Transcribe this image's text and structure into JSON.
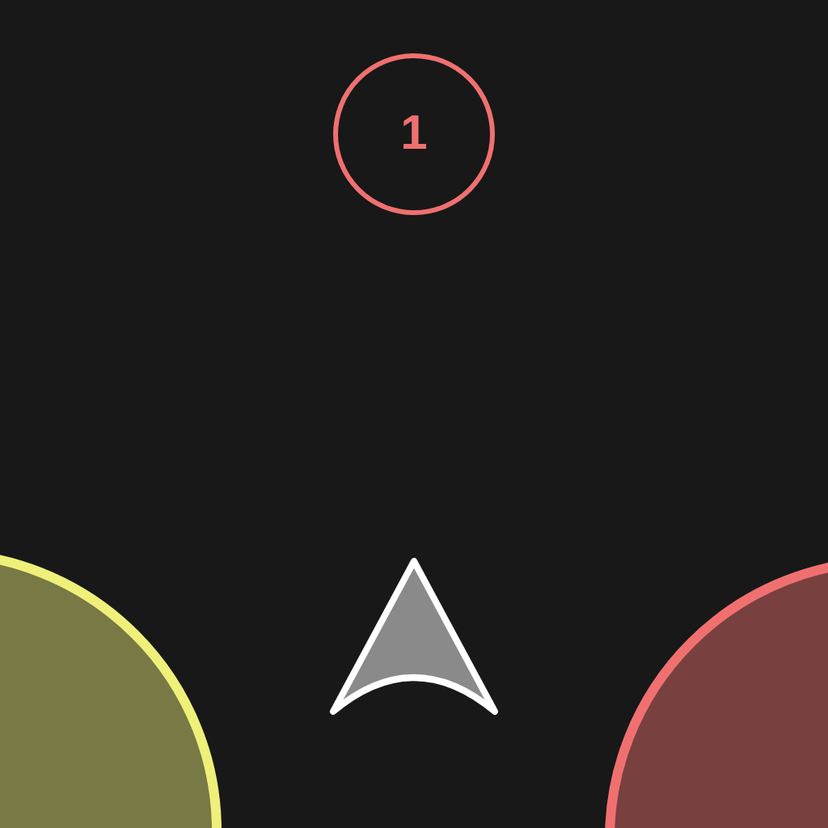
{
  "counter": {
    "text": "1"
  },
  "orbs": [
    {
      "color": "#eef07a"
    },
    {
      "color": "#f07070"
    }
  ]
}
